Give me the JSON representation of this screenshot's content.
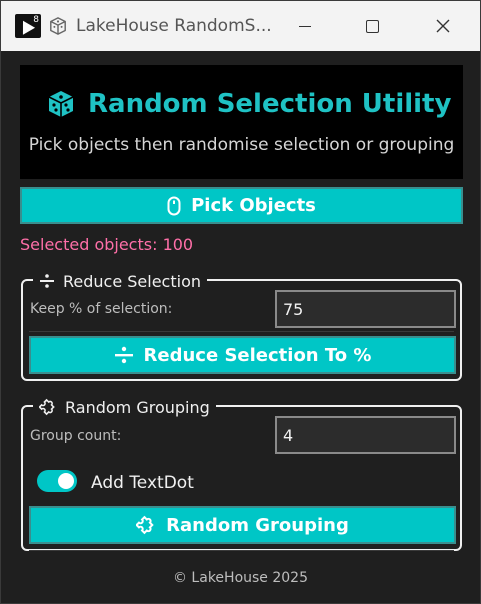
{
  "window": {
    "title": "LakeHouse RandomS...",
    "app_badge": "8"
  },
  "header": {
    "title": "Random Selection Utility",
    "subtitle": "Pick objects then randomise selection or grouping"
  },
  "pick_button": {
    "label": "Pick Objects",
    "icon": "mouse-icon"
  },
  "status": {
    "selected_text": "Selected objects: 100"
  },
  "reduce": {
    "legend": "Reduce Selection",
    "legend_icon": "divide-icon",
    "keep_label": "Keep % of selection:",
    "keep_value": "75",
    "button_label": "Reduce Selection To %"
  },
  "grouping": {
    "legend": "Random Grouping",
    "legend_icon": "puzzle-icon",
    "count_label": "Group count:",
    "count_value": "4",
    "textdot_label": "Add TextDot",
    "textdot_on": true,
    "button_label": "Random Grouping"
  },
  "footer": {
    "text": "© LakeHouse 2025"
  },
  "colors": {
    "accent": "#00c6c6",
    "title_teal": "#1fc2c4",
    "status_pink": "#ff6fa8",
    "background": "#1f1f1f"
  }
}
